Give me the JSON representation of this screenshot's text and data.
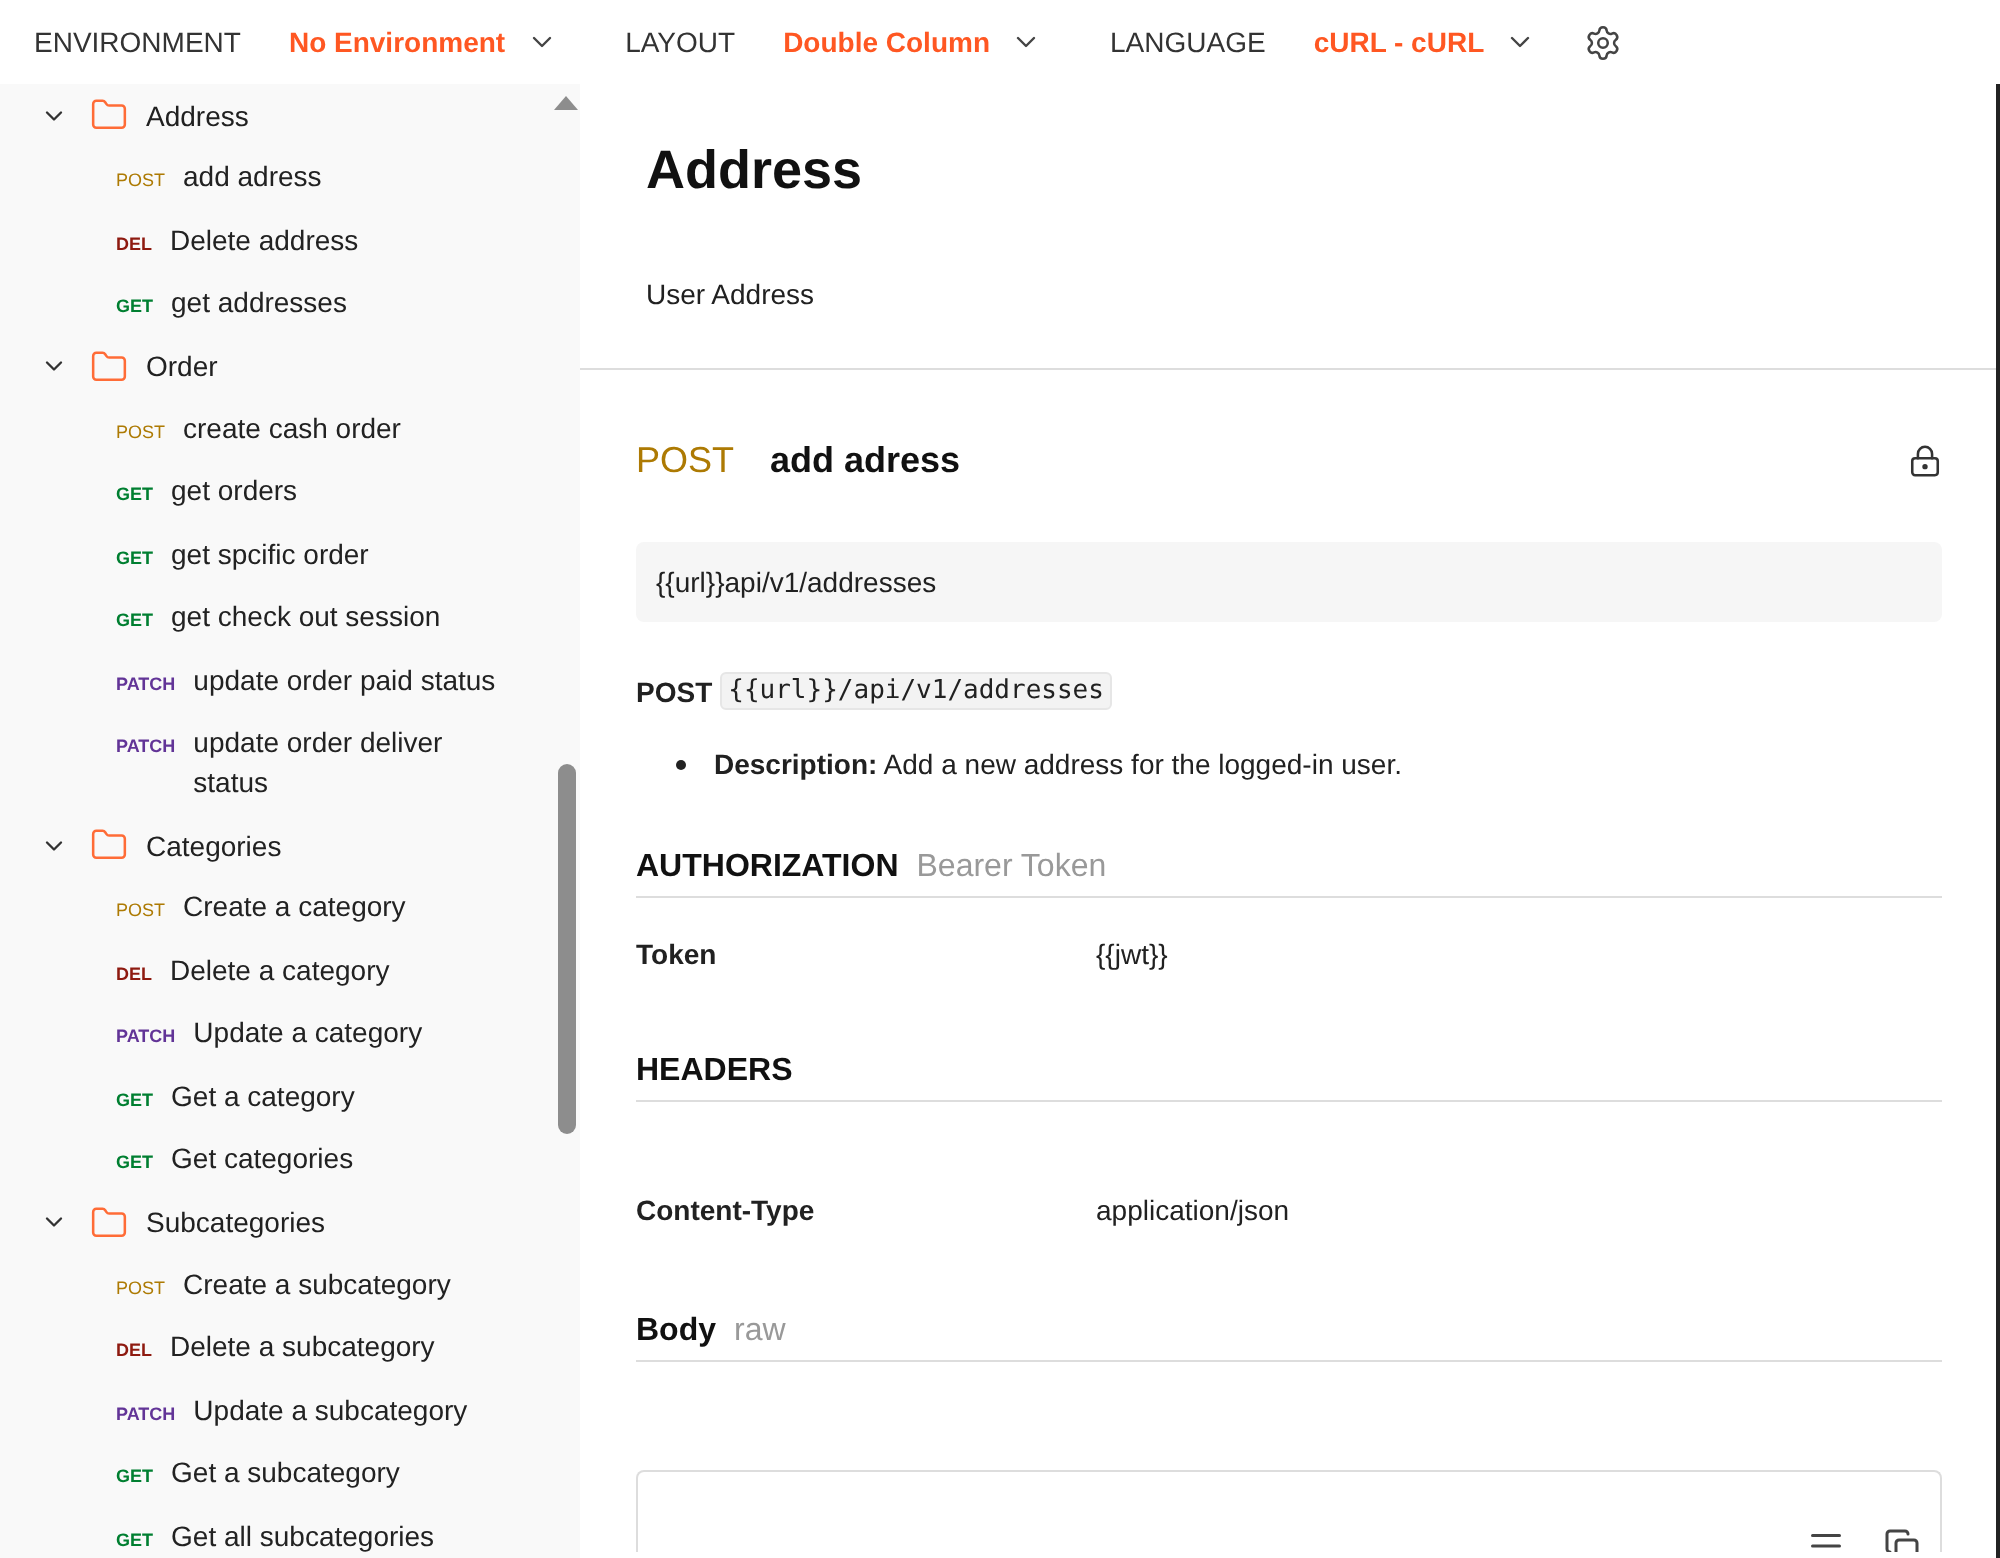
{
  "topbar": {
    "fields": [
      {
        "label": "ENVIRONMENT",
        "value": "No Environment"
      },
      {
        "label": "LAYOUT",
        "value": "Double Column"
      },
      {
        "label": "LANGUAGE",
        "value": "cURL - cURL"
      }
    ]
  },
  "sidebar": {
    "folders": [
      {
        "name": "Address",
        "expanded": true,
        "children": [
          {
            "method": "POST",
            "name": "add adress"
          },
          {
            "method": "DEL",
            "name": "Delete address"
          },
          {
            "method": "GET",
            "name": "get addresses"
          }
        ]
      },
      {
        "name": "Order",
        "expanded": true,
        "children": [
          {
            "method": "POST",
            "name": "create cash order"
          },
          {
            "method": "GET",
            "name": "get orders"
          },
          {
            "method": "GET",
            "name": "get spcific order"
          },
          {
            "method": "GET",
            "name": "get check out session"
          },
          {
            "method": "PATCH",
            "name": "update order paid status"
          },
          {
            "method": "PATCH",
            "name": "update order deliver status"
          }
        ]
      },
      {
        "name": "Categories",
        "expanded": true,
        "children": [
          {
            "method": "POST",
            "name": "Create a category"
          },
          {
            "method": "DEL",
            "name": "Delete a category"
          },
          {
            "method": "PATCH",
            "name": "Update a category"
          },
          {
            "method": "GET",
            "name": "Get a category"
          },
          {
            "method": "GET",
            "name": "Get categories"
          }
        ]
      },
      {
        "name": "Subcategories",
        "expanded": true,
        "children": [
          {
            "method": "POST",
            "name": "Create a subcategory"
          },
          {
            "method": "DEL",
            "name": "Delete a subcategory"
          },
          {
            "method": "PATCH",
            "name": "Update a subcategory"
          },
          {
            "method": "GET",
            "name": "Get a subcategory"
          },
          {
            "method": "GET",
            "name": "Get all subcategories"
          }
        ]
      }
    ]
  },
  "collection": {
    "title": "Address",
    "description": "User Address"
  },
  "request": {
    "method": "POST",
    "name": "add adress",
    "url": "{{url}}api/v1/addresses",
    "method_label": "POST",
    "path": "{{url}}/api/v1/addresses",
    "description": "**Description:** Add a new address for the logged-in user."
  },
  "authorization": {
    "heading": "AUTHORIZATION",
    "type": "Bearer Token",
    "rows": [
      {
        "key": "Token",
        "value": "{{jwt}}"
      }
    ]
  },
  "headers": {
    "heading": "HEADERS",
    "rows": [
      {
        "key": "Content-Type",
        "value": "application/json"
      }
    ]
  },
  "body": {
    "heading": "Body",
    "mode": "raw"
  }
}
